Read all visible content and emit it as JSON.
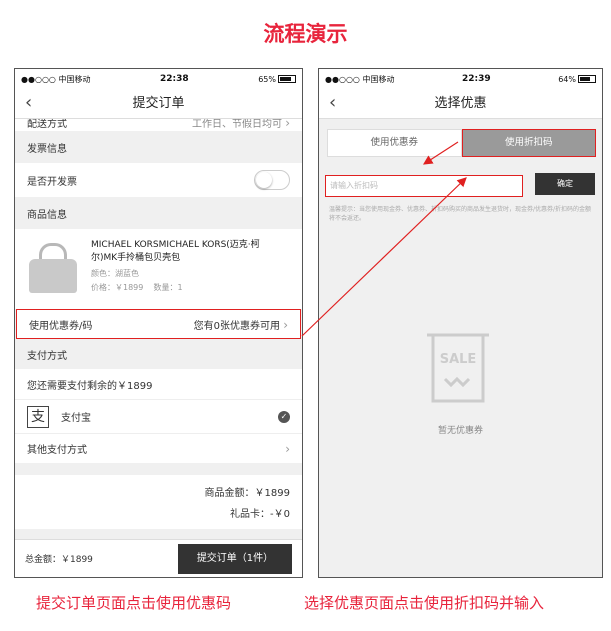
{
  "title": "流程演示",
  "colors": {
    "accent": "#e8243c",
    "highlight": "#e02020",
    "dark_button": "#333333",
    "active_tab": "#9a9a9a"
  },
  "left_phone": {
    "status": {
      "carrier": "●●○○○ 中国移动",
      "time": "22:38",
      "battery": "65%"
    },
    "nav_title": "提交订单",
    "delivery": {
      "label": "配送方式",
      "value": "工作日、节假日均可"
    },
    "invoice": {
      "section": "发票信息",
      "toggle_label": "是否开发票"
    },
    "product": {
      "section": "商品信息",
      "name": "MICHAEL KORSMICHAEL KORS(迈克·柯尔)MK手拎桶包贝壳包",
      "color": "颜色：湖蓝色",
      "price": "价格：￥1899",
      "quantity": "数量：1"
    },
    "coupon": {
      "label": "使用优惠券/码",
      "value": "您有0张优惠券可用"
    },
    "payment": {
      "section": "支付方式",
      "remaining": "您还需要支付剩余的￥1899",
      "alipay_icon": "支",
      "alipay": "支付宝",
      "other": "其他支付方式"
    },
    "summary": {
      "goods_amount": "商品金额：￥1899",
      "gift_card": "礼品卡：-￥0"
    },
    "footer": {
      "total": "总金额：￥1899",
      "submit": "提交订单（1件）"
    }
  },
  "right_phone": {
    "status": {
      "carrier": "●●○○○ 中国移动",
      "time": "22:39",
      "battery": "64%"
    },
    "nav_title": "选择优惠",
    "tabs": [
      "使用优惠券",
      "使用折扣码"
    ],
    "input_placeholder": "请输入折扣码",
    "confirm": "确定",
    "hint": "温馨提示：当您使用现金券、优惠券、折扣码购买的商品发生退货时，现金券/优惠券/折扣码的金额将不会返还。",
    "empty_icon_text": "SALE",
    "empty_text": "暂无优惠券"
  },
  "captions": {
    "left": "提交订单页面点击使用优惠码",
    "right": "选择优惠页面点击使用折扣码并输入"
  }
}
